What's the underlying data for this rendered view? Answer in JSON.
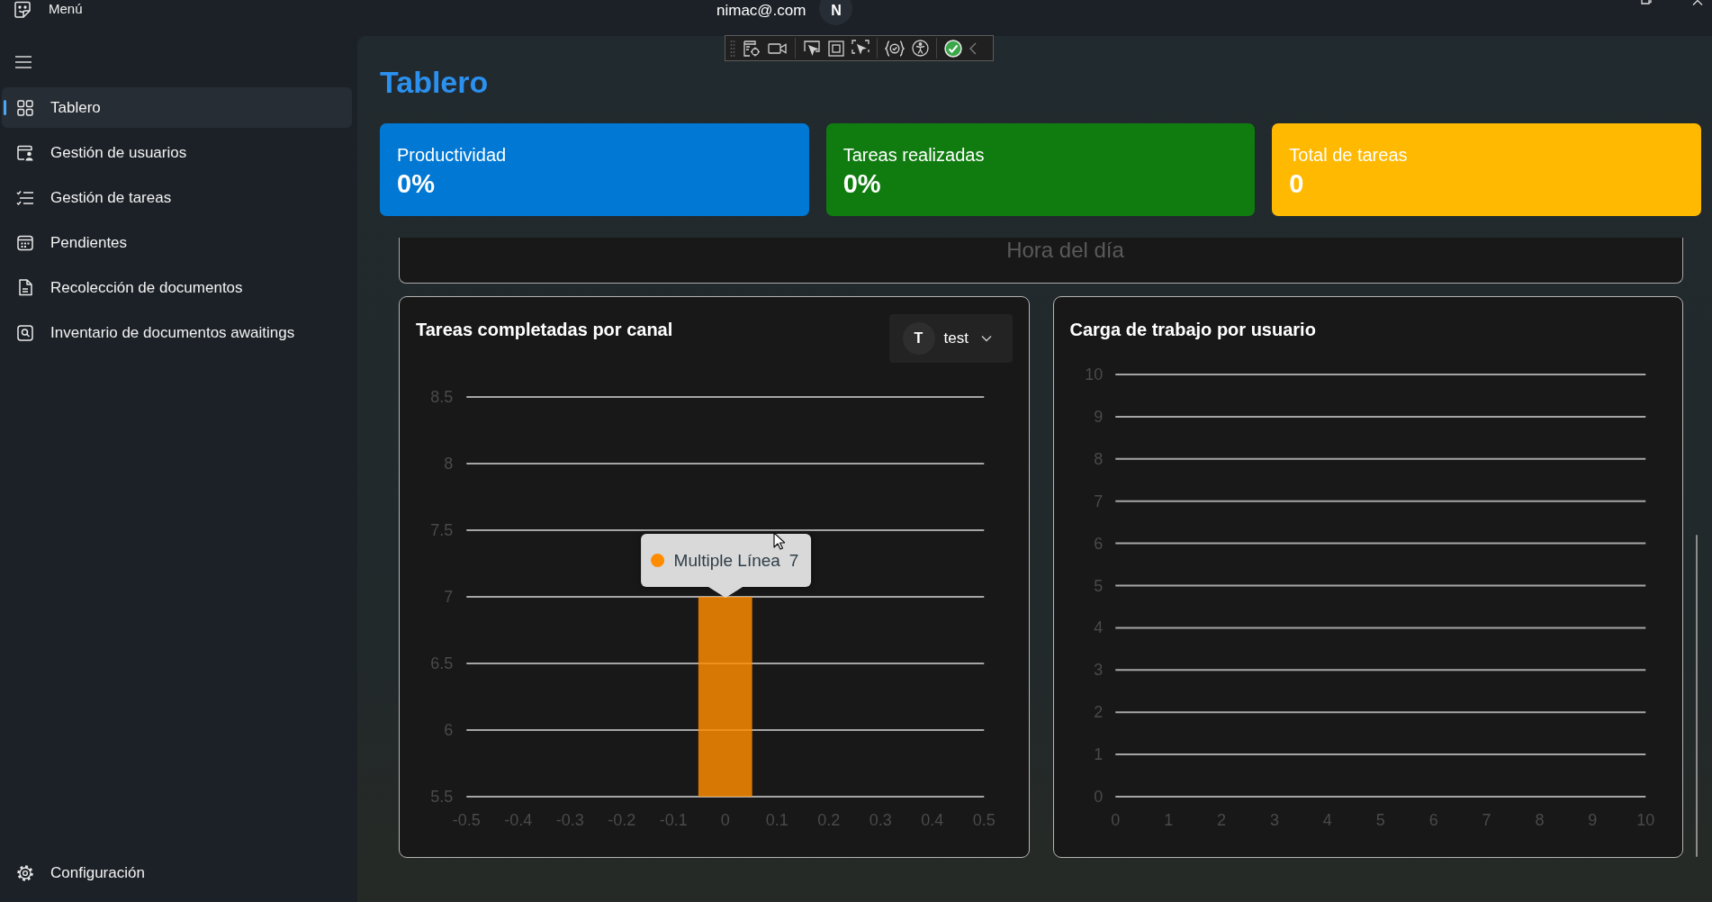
{
  "title_bar": {
    "app_label": "Menú",
    "user_email": "nimac@.com",
    "avatar_initial": "N"
  },
  "sidebar": {
    "items": [
      {
        "label": "Tablero",
        "selected": true
      },
      {
        "label": "Gestión de usuarios",
        "selected": false
      },
      {
        "label": "Gestión de tareas",
        "selected": false
      },
      {
        "label": "Pendientes",
        "selected": false
      },
      {
        "label": "Recolección de documentos",
        "selected": false
      },
      {
        "label": "Inventario de documentos awaitings",
        "selected": false
      }
    ],
    "footer_items": [
      {
        "label": "Configuración",
        "selected": false
      }
    ]
  },
  "page": {
    "title": "Tablero"
  },
  "stat_cards": [
    {
      "label": "Productividad",
      "value": "0%",
      "color": "#0078d4"
    },
    {
      "label": "Tareas realizadas",
      "value": "0%",
      "color": "#107c10"
    },
    {
      "label": "Total de tareas",
      "value": "0",
      "color": "#ffb900"
    }
  ],
  "scrolled_panel": {
    "caption": "Hora del día"
  },
  "charts": [
    {
      "title": "Tareas completadas por canal",
      "filter": {
        "avatar_initial": "T",
        "value": "test"
      },
      "tooltip": {
        "value": "7"
      },
      "chart_data": {
        "type": "bar",
        "x": [
          0
        ],
        "series": [
          {
            "name": "Multiple Línea",
            "color": "#ff8c00",
            "values": [
              7
            ]
          }
        ],
        "xlim": [
          -0.5,
          0.5
        ],
        "ylim": [
          5.5,
          8.5
        ],
        "xticks": [
          -0.5,
          -0.4,
          -0.3,
          -0.2,
          -0.1,
          0,
          0.1,
          0.2,
          0.3,
          0.4,
          0.5
        ],
        "yticks": [
          5.5,
          6,
          6.5,
          7,
          7.5,
          8,
          8.5
        ],
        "grid": true
      }
    },
    {
      "title": "Carga de trabajo por usuario",
      "chart_data": {
        "type": "line",
        "xlim": [
          0,
          10
        ],
        "ylim": [
          0,
          10
        ],
        "xticks": [
          0,
          1,
          2,
          3,
          4,
          5,
          6,
          7,
          8,
          9,
          10
        ],
        "yticks": [
          0,
          1,
          2,
          3,
          4,
          5,
          6,
          7,
          8,
          9,
          10
        ],
        "grid": true
      }
    }
  ]
}
